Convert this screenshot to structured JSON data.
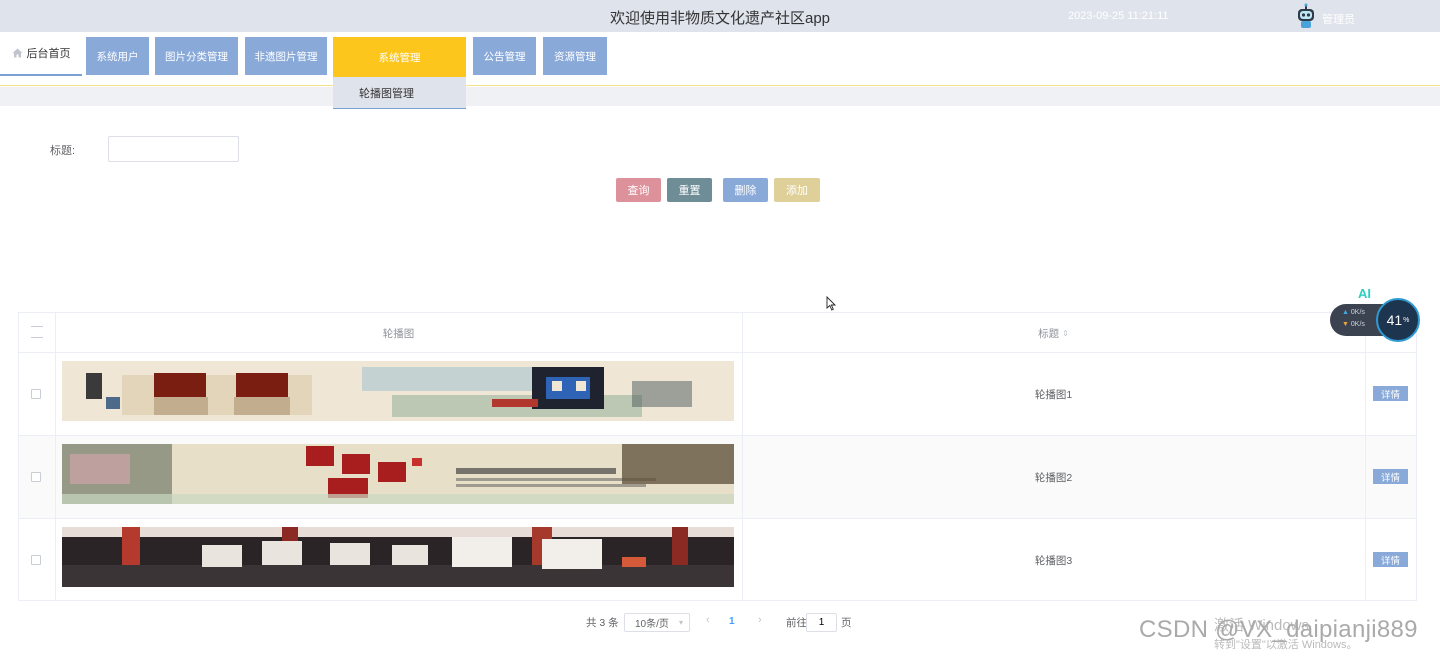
{
  "header": {
    "title": "欢迎使用非物质文化遗产社区app",
    "datetime": "2023-09-25 11:21:11",
    "role": "管理员",
    "accent": "#dfe3ec"
  },
  "nav": {
    "home": "后台首页",
    "items": [
      "系统用户",
      "图片分类管理",
      "非遗图片管理",
      "系统管理",
      "公告管理",
      "资源管理"
    ],
    "active": "系统管理",
    "submenu": "轮播图管理",
    "colors": {
      "item": "#89a9d8",
      "active": "#fdc61c"
    }
  },
  "search": {
    "label": "标题:",
    "value": "",
    "placeholder": ""
  },
  "actions": {
    "query": "查询",
    "reset": "重置",
    "delete": "删除",
    "add": "添加",
    "colors": {
      "query": "#dd919b",
      "reset": "#6e8d96",
      "delete": "#89a9d8",
      "add": "#dfd09a"
    }
  },
  "table": {
    "columns": {
      "image": "轮播图",
      "title": "标题"
    },
    "rows": [
      {
        "title": "轮播图1",
        "action": "详情"
      },
      {
        "title": "轮播图2",
        "action": "详情"
      },
      {
        "title": "轮播图3",
        "action": "详情"
      }
    ]
  },
  "pagination": {
    "total": "共 3 条",
    "page_size": "10条/页",
    "current_page": "1",
    "goto_prefix": "前往",
    "goto_value": "1",
    "goto_suffix": "页"
  },
  "overlay": {
    "ai_label": "AI",
    "upload": "0K/s",
    "download": "0K/s",
    "cpu_value": "41",
    "cpu_unit": "%"
  },
  "watermark": {
    "csdn": "CSDN @VX_daipianji889",
    "windows_title": "激活 Windows",
    "windows_sub": "转到\"设置\"以激活 Windows。"
  }
}
